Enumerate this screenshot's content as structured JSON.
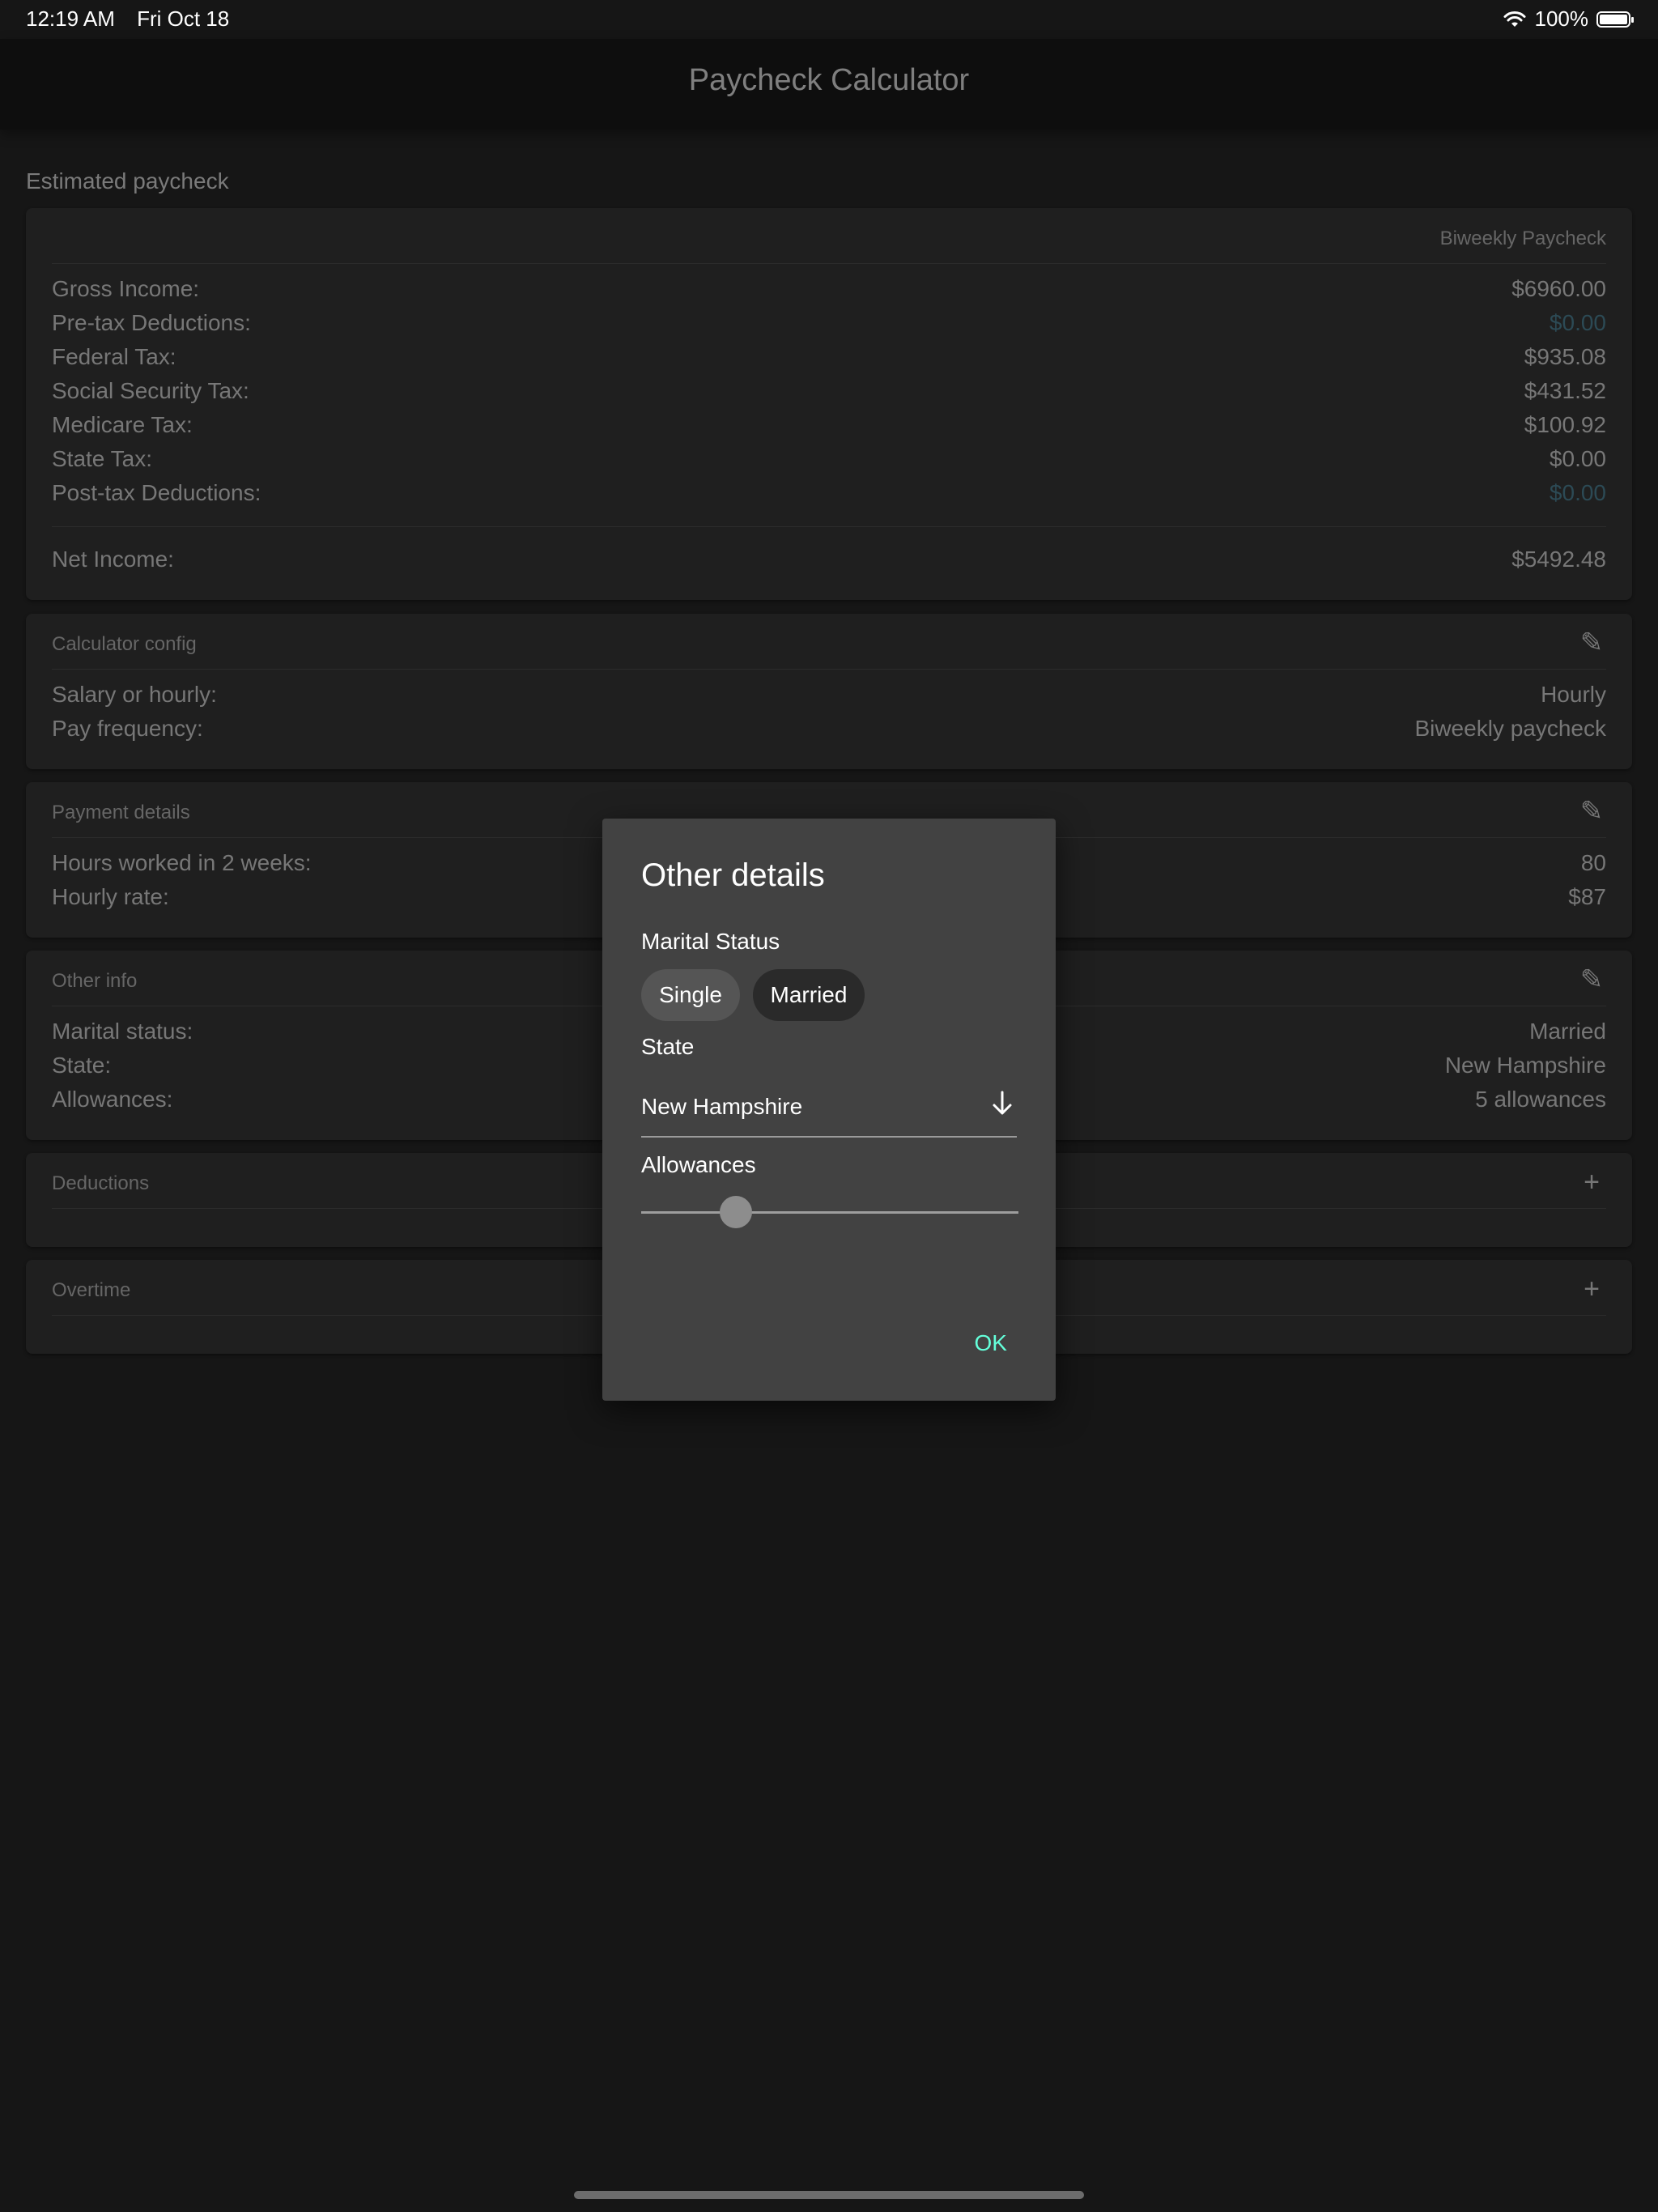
{
  "status_bar": {
    "time": "12:19 AM",
    "date": "Fri Oct 18",
    "battery": "100%"
  },
  "header": {
    "title": "Paycheck Calculator"
  },
  "estimate": {
    "section_label": "Estimated paycheck",
    "period": "Biweekly Paycheck",
    "rows": [
      {
        "label": "Gross Income:",
        "value": "$6960.00"
      },
      {
        "label": "Pre-tax Deductions:",
        "value": "$0.00"
      },
      {
        "label": "Federal Tax:",
        "value": "$935.08"
      },
      {
        "label": "Social Security Tax:",
        "value": "$431.52"
      },
      {
        "label": "Medicare Tax:",
        "value": "$100.92"
      },
      {
        "label": "State Tax:",
        "value": "$0.00"
      },
      {
        "label": "Post-tax Deductions:",
        "value": "$0.00"
      }
    ],
    "net": {
      "label": "Net Income:",
      "value": "$5492.48"
    }
  },
  "calculator_config": {
    "title": "Calculator config",
    "rows": [
      {
        "label": "Salary or hourly:",
        "value": "Hourly"
      },
      {
        "label": "Pay frequency:",
        "value": "Biweekly paycheck"
      }
    ]
  },
  "payment_details": {
    "title": "Payment details",
    "rows": [
      {
        "label": "Hours worked in 2 weeks:",
        "value": "80"
      },
      {
        "label": "Hourly rate:",
        "value": "$87"
      }
    ]
  },
  "other_info": {
    "title": "Other info",
    "rows": [
      {
        "label": "Marital status:",
        "value": "Married"
      },
      {
        "label": "State:",
        "value": "New Hampshire"
      },
      {
        "label": "Allowances:",
        "value": "5 allowances"
      }
    ]
  },
  "deductions": {
    "title": "Deductions"
  },
  "overtime": {
    "title": "Overtime"
  },
  "dialog": {
    "title": "Other details",
    "marital_label": "Marital Status",
    "marital_options": [
      "Single",
      "Married"
    ],
    "marital_selected": "Married",
    "state_label": "State",
    "state_value": "New Hampshire",
    "allowances_label": "Allowances",
    "allowances_slider_fraction": 0.25,
    "ok_label": "OK"
  },
  "colors": {
    "background": "#161616",
    "card": "#1f1f1f",
    "dialog": "#424242",
    "accent": "#64ffda",
    "muted_value": "#2c4a55"
  },
  "icons": [
    "wifi-icon",
    "battery-icon",
    "edit-icon",
    "add-icon",
    "arrow-down-icon"
  ]
}
